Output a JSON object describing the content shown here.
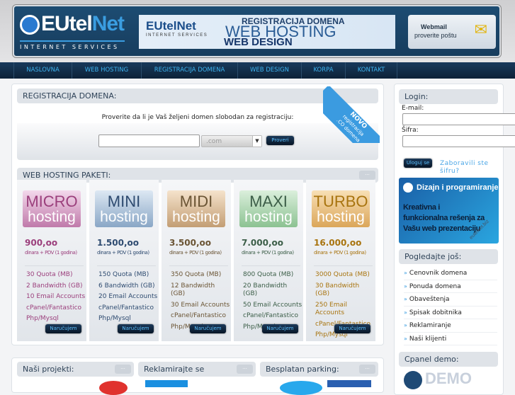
{
  "header": {
    "logo_name_a": "EUtel",
    "logo_name_b": "Net",
    "logo_sub": "INTERNET SERVICES",
    "banner": {
      "brand": "EUtelNet",
      "brand_sub": "INTERNET SERVICES",
      "line1": "REGISTRACIJA DOMENA",
      "line2": "WEB HOSTING",
      "line3": "WEB DESIGN"
    },
    "webmail": {
      "title": "Webmail",
      "subtitle": "proverite poštu"
    }
  },
  "nav": [
    "NASLOVNA",
    "WEB HOSTING",
    "REGISTRACIJA DOMENA",
    "WEB DESIGN",
    "KORPA",
    "KONTAKT"
  ],
  "domain": {
    "title": "REGISTRACIJA DOMENA:",
    "prompt": "Proverite da li je Vaš željeni domen slobodan za registraciju:",
    "input_value": "",
    "tld": ".com",
    "button": "Proveri",
    "ribbon": {
      "l1": "NOVO",
      "l2": "registracija",
      "l3": ".CO domena"
    }
  },
  "hosting": {
    "title": "WEB HOSTING PAKETI:",
    "more": "...",
    "order_label": "Naručujem",
    "packages": [
      {
        "name": "MICRO",
        "sub": "hosting",
        "price": "900,oo",
        "price_note": "dinara + PDV (1 godina)",
        "color": "#9b3f7c",
        "features": [
          "30 Quota (MB)",
          "2 Bandwidth (GB)",
          "10 Email Accounts",
          "cPanel/Fantastico",
          "Php/Mysql"
        ]
      },
      {
        "name": "MINI",
        "sub": "hosting",
        "price": "1.500,oo",
        "price_note": "dinara + PDV (1 godina)",
        "color": "#2e4b70",
        "features": [
          "150 Quota (MB)",
          "6 Bandwidth (GB)",
          "20 Email Accounts",
          "cPanel/Fantastico",
          "Php/Mysql"
        ]
      },
      {
        "name": "MIDI",
        "sub": "hosting",
        "price": "3.500,oo",
        "price_note": "dinara + PDV (1 godina)",
        "color": "#6a5434",
        "features": [
          "350 Quota (MB)",
          "12 Bandwidth (GB)",
          "30 Email Accounts",
          "cPanel/Fantastico",
          "Php/Mysql"
        ]
      },
      {
        "name": "MAXI",
        "sub": "hosting",
        "price": "7.000,oo",
        "price_note": "dinara + PDV (1 godina)",
        "color": "#3c5e48",
        "features": [
          "800 Quota (MB)",
          "20 Bandwidth (GB)",
          "50 Email Accounts",
          "cPanel/Fantastico",
          "Php/Mysql"
        ]
      },
      {
        "name": "TURBO",
        "sub": "hosting",
        "price": "16.000,oo",
        "price_note": "dinara + PDV (1 godina)",
        "color": "#a8740f",
        "features": [
          "3000 Quota (MB)",
          "30 Bandwidth (GB)",
          "250 Email Accounts",
          "cPanel/Fantastico",
          "Php/Mysql"
        ]
      }
    ]
  },
  "bottom": [
    {
      "title": "Naši projekti:",
      "more": "..."
    },
    {
      "title": "Reklamirajte se",
      "more": "..."
    },
    {
      "title": "Besplatan parking:",
      "more": "..."
    }
  ],
  "login": {
    "title": "Login:",
    "email_label": "E-mail:",
    "email_value": "",
    "password_label": "Šifra:",
    "password_value": "",
    "submit": "Uloguj se",
    "forgot": "Zaboravili ste šifru?"
  },
  "ad": {
    "title": "Dizajn i programiranje",
    "body": "Kreativna i funkcionalna rešenja za Vašu web prezentaciju",
    "url": "eutelnet.biz"
  },
  "more": {
    "title": "Pogledajte još:",
    "links": [
      "Cenovnik domena",
      "Ponuda domena",
      "Obaveštenja",
      "Spisak dobitnika",
      "Reklamiranje",
      "Naši klijenti"
    ]
  },
  "cpanel": {
    "title": "Cpanel demo:",
    "logo_text": "DEMO"
  }
}
